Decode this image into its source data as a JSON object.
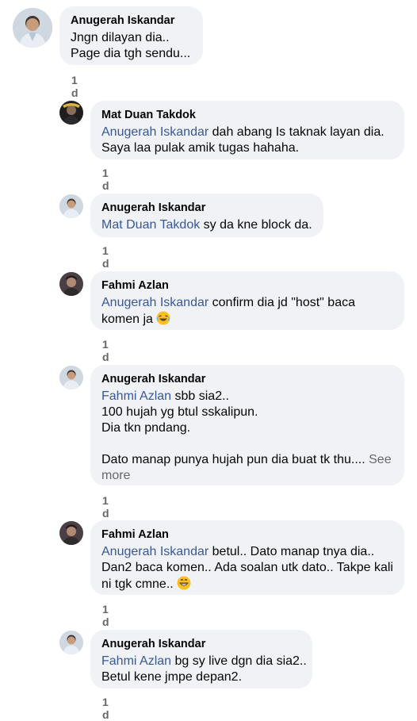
{
  "comments": [
    {
      "author": "Anugerah Iskandar",
      "lines": [
        {
          "text": "Jngn dilayan dia.."
        },
        {
          "text": "Page dia tgh sendu..."
        }
      ],
      "time": "1 d",
      "avatar": "person-avatar-light"
    },
    {
      "author": "Mat Duan Takdok",
      "mention": "Anugerah Iskandar",
      "lines": [
        {
          "text": " dah abang Is taknak layan dia."
        },
        {
          "text": "Saya laa pulak amik tugas hahaha."
        }
      ],
      "time": "1 d",
      "avatar": "person-avatar-dark"
    },
    {
      "author": "Anugerah Iskandar",
      "mention": "Mat Duan Takdok",
      "lines": [
        {
          "text": " sy da kne block da."
        }
      ],
      "time": "1 d",
      "avatar": "person-avatar-light"
    },
    {
      "author": "Fahmi Azlan",
      "mention": "Anugerah Iskandar",
      "lines": [
        {
          "text": " confirm dia jd \"host\" baca"
        },
        {
          "text": "komen ja"
        }
      ],
      "time": "1 d",
      "avatar": "person-avatar-mid",
      "emoji": "laughing-emoji"
    },
    {
      "author": "Anugerah Iskandar",
      "mention": "Fahmi Azlan",
      "lines": [
        {
          "text": " sbb sia2.."
        },
        {
          "text": "100 hujah yg btul sskalipun."
        },
        {
          "text": "Dia tkn pndang."
        },
        {
          "text": ""
        },
        {
          "text": "Dato manap punya hujah pun dia buat tk thu.... "
        }
      ],
      "see_more_1": "See",
      "see_more_2": "more",
      "time": "1 d",
      "avatar": "person-avatar-light"
    },
    {
      "author": "Fahmi Azlan",
      "mention": "Anugerah Iskandar",
      "lines": [
        {
          "text": " betul.. Dato manap tnya dia.."
        },
        {
          "text": "Dan2 baca komen.. Ada soalan utk dato.. Takpe kali"
        },
        {
          "text": "ni tgk cmne.. "
        }
      ],
      "time": "1 d",
      "avatar": "person-avatar-mid",
      "emoji": "grinning-emoji"
    },
    {
      "author": "Anugerah Iskandar",
      "mention": "Fahmi Azlan",
      "lines": [
        {
          "text": " bg sy live dgn dia sia2.."
        },
        {
          "text": "Betul kene jmpe depan2."
        }
      ],
      "time": "1 d",
      "avatar": "person-avatar-light"
    }
  ]
}
